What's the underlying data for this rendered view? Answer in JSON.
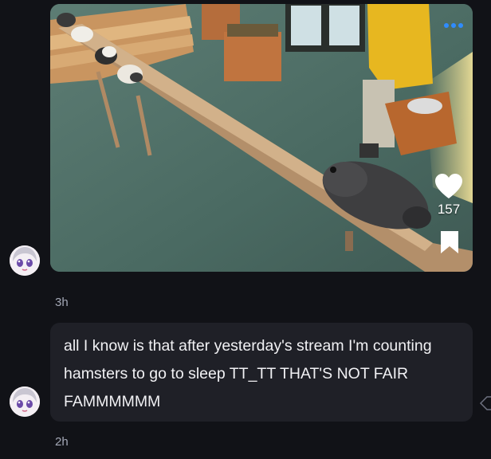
{
  "post": {
    "media_alt_icon": "guinea-pig-gif",
    "like_icon": "heart-icon",
    "like_count": "157",
    "bookmark_icon": "bookmark-icon",
    "more_icon": "more-dots-icon",
    "timestamp": "3h"
  },
  "comment": {
    "text": "all I know is that after yesterday's stream I'm counting hamsters to go to sleep TT_TT THAT'S NOT FAIR FAMMMMMM",
    "timestamp": "2h",
    "react_icon": "react-icon"
  },
  "colors": {
    "background": "#111217",
    "bubble": "#1f2027",
    "text": "#f1f1f4",
    "muted": "#a4a8b6",
    "accent": "#2f8cff"
  }
}
